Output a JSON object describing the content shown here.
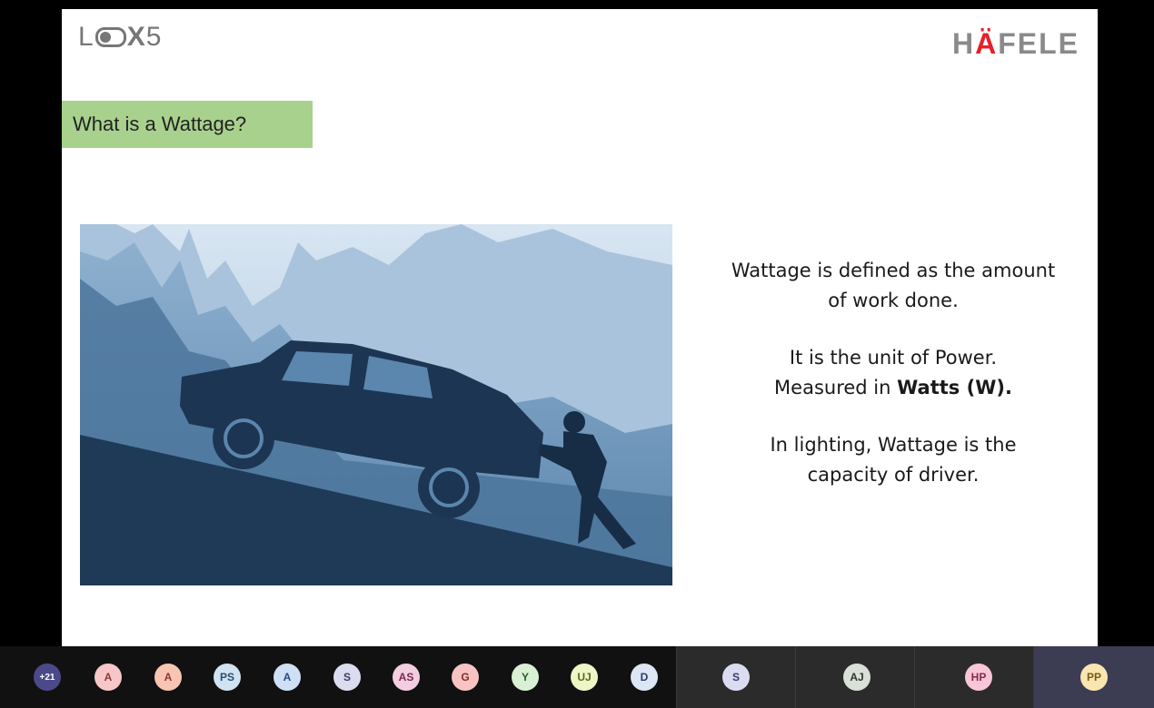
{
  "slide": {
    "logo_left_prefix": "L",
    "logo_left_suffix": "X",
    "logo_left_number": "5",
    "logo_right_pre": "H",
    "logo_right_accent": "Ä",
    "logo_right_post": "FELE",
    "title": "What is a Wattage?",
    "para1": "Wattage is defined as the amount of work done.",
    "para2_line1": "It is the unit of Power.",
    "para2_line2_pre": "Measured in ",
    "para2_line2_bold": "Watts (W).",
    "para3": "In lighting, Wattage is the capacity of driver."
  },
  "participants": {
    "more_count": "+21",
    "small": [
      {
        "initials": "A",
        "bg": "#f7c6c8",
        "fg": "#8a3a3a"
      },
      {
        "initials": "A",
        "bg": "#f9c4b2",
        "fg": "#8a3a2a"
      },
      {
        "initials": "PS",
        "bg": "#cfe3f3",
        "fg": "#2a4d6e"
      },
      {
        "initials": "A",
        "bg": "#cfe0f5",
        "fg": "#2a4a7a"
      },
      {
        "initials": "S",
        "bg": "#dcdcf0",
        "fg": "#3a3a6a"
      },
      {
        "initials": "AS",
        "bg": "#f3cde0",
        "fg": "#7a2a4a"
      },
      {
        "initials": "G",
        "bg": "#f8c3c3",
        "fg": "#8a2a2a"
      },
      {
        "initials": "Y",
        "bg": "#d9f0d4",
        "fg": "#2a5a2a"
      },
      {
        "initials": "UJ",
        "bg": "#eef5c6",
        "fg": "#5a6a1a"
      },
      {
        "initials": "D",
        "bg": "#dde6f5",
        "fg": "#2a3a6a"
      }
    ],
    "tiles": [
      {
        "initials": "S",
        "bg": "#dcdcf0",
        "fg": "#3a3a6a"
      },
      {
        "initials": "AJ",
        "bg": "#d8e0d8",
        "fg": "#2a3a2a"
      },
      {
        "initials": "HP",
        "bg": "#f7c6d8",
        "fg": "#8a2a4a"
      },
      {
        "initials": "PP",
        "bg": "#f8e6b0",
        "fg": "#7a5a10"
      }
    ]
  },
  "colors": {
    "title_bg": "#a9d18e",
    "brand_red": "#e4202a",
    "more_avatar_bg": "#4a4a8a"
  }
}
